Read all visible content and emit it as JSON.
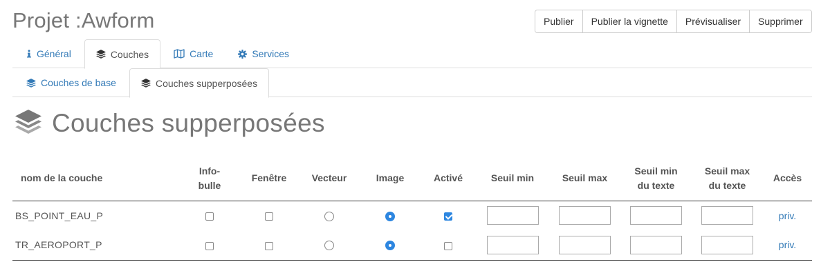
{
  "header": {
    "title": "Projet :Awform",
    "buttons": [
      "Publier",
      "Publier la vignette",
      "Prévisualiser",
      "Supprimer"
    ]
  },
  "main_tabs": [
    {
      "label": "Général",
      "icon": "info-icon"
    },
    {
      "label": "Couches",
      "icon": "layers-icon",
      "active": true
    },
    {
      "label": "Carte",
      "icon": "map-icon"
    },
    {
      "label": "Services",
      "icon": "gear-icon"
    }
  ],
  "sub_tabs": [
    {
      "label": "Couches de base",
      "icon": "layers-icon"
    },
    {
      "label": "Couches supperposées",
      "icon": "layers-icon",
      "active": true
    }
  ],
  "section": {
    "title": "Couches supperposées",
    "icon": "layers-icon"
  },
  "table": {
    "headers": {
      "name": "nom de la couche",
      "infobulle_1": "Info-",
      "infobulle_2": "bulle",
      "fenetre": "Fenêtre",
      "vecteur": "Vecteur",
      "image": "Image",
      "active": "Activé",
      "seuil_min": "Seuil min",
      "seuil_max": "Seuil max",
      "seuil_min_texte_1": "Seuil min",
      "seuil_min_texte_2": "du texte",
      "seuil_max_texte_1": "Seuil max",
      "seuil_max_texte_2": "du texte",
      "acces": "Accès"
    },
    "rows": [
      {
        "name": "BS_POINT_EAU_P",
        "infobulle": false,
        "fenetre": false,
        "type": "image",
        "active": true,
        "seuil_min": "",
        "seuil_max": "",
        "seuil_min_texte": "",
        "seuil_max_texte": "",
        "acces": "priv."
      },
      {
        "name": "TR_AEROPORT_P",
        "infobulle": false,
        "fenetre": false,
        "type": "image",
        "active": false,
        "seuil_min": "",
        "seuil_max": "",
        "seuil_min_texte": "",
        "seuil_max_texte": "",
        "acces": "priv."
      }
    ]
  },
  "colors": {
    "link": "#337ab7",
    "accent": "#2d86e0",
    "title": "#777777"
  }
}
